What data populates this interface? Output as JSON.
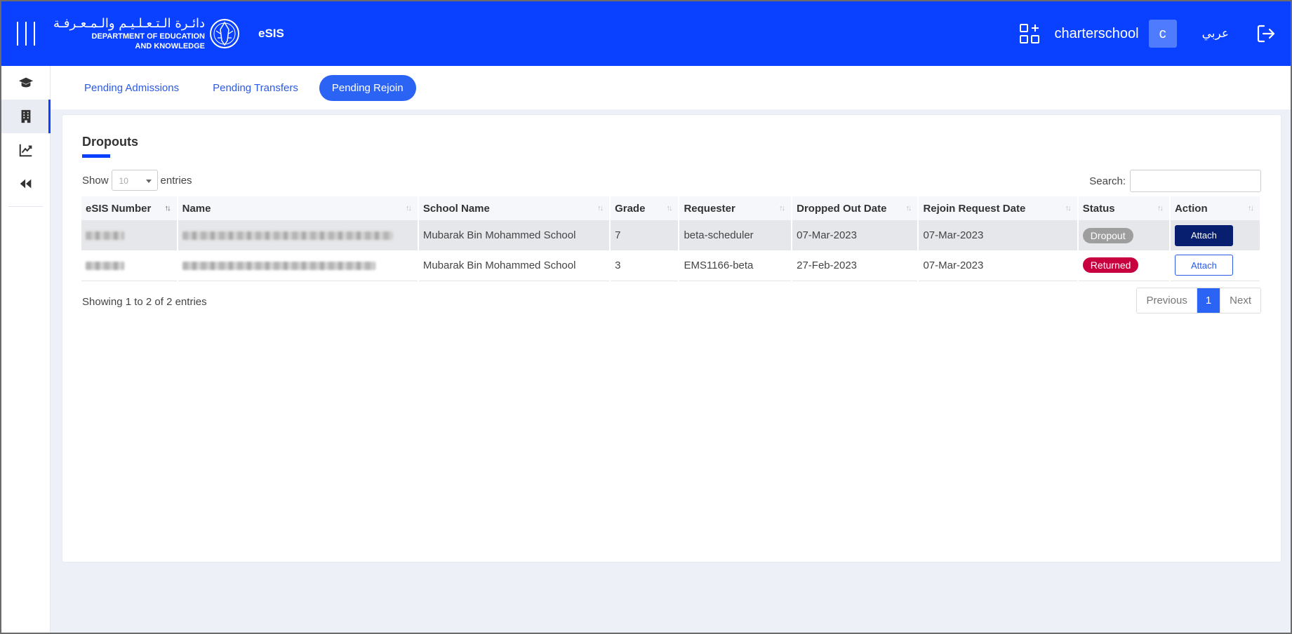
{
  "header": {
    "logo_ar": "دائـرة الـتـعـلـيـم والـمـعـرفـة",
    "logo_en_line1": "DEPARTMENT OF EDUCATION",
    "logo_en_line2": "AND KNOWLEDGE",
    "app_name": "eSIS",
    "username": "charterschool",
    "avatar_initial": "c",
    "language_toggle": "عربي",
    "color": "#0a40ff"
  },
  "sidebar": {
    "items": [
      {
        "icon": "graduation-cap-icon",
        "active": false
      },
      {
        "icon": "building-icon",
        "active": true
      },
      {
        "icon": "chart-line-icon",
        "active": false
      },
      {
        "icon": "rewind-icon",
        "active": false
      }
    ]
  },
  "tabs": [
    {
      "label": "Pending Admissions",
      "active": false
    },
    {
      "label": "Pending Transfers",
      "active": false
    },
    {
      "label": "Pending Rejoin",
      "active": true
    }
  ],
  "card": {
    "title": "Dropouts",
    "show_label": "Show",
    "entries_label": "entries",
    "page_size": "10",
    "search_label": "Search:",
    "search_value": "",
    "columns": [
      "eSIS Number",
      "Name",
      "School Name",
      "Grade",
      "Requester",
      "Dropped Out Date",
      "Rejoin Request Date",
      "Status",
      "Action"
    ],
    "rows": [
      {
        "esis_number": "",
        "name": "",
        "school": "Mubarak Bin Mohammed School",
        "grade": "7",
        "requester": "beta-scheduler",
        "dropped_date": "07-Mar-2023",
        "rejoin_date": "07-Mar-2023",
        "status": "Dropout",
        "action": "Attach"
      },
      {
        "esis_number": "",
        "name": "",
        "school": "Mubarak Bin Mohammed School",
        "grade": "3",
        "requester": "EMS1166-beta",
        "dropped_date": "27-Feb-2023",
        "rejoin_date": "07-Mar-2023",
        "status": "Returned",
        "action": "Attach"
      }
    ],
    "showing_text": "Showing 1 to 2 of 2 entries",
    "pagination": {
      "previous": "Previous",
      "current": "1",
      "next": "Next"
    }
  }
}
